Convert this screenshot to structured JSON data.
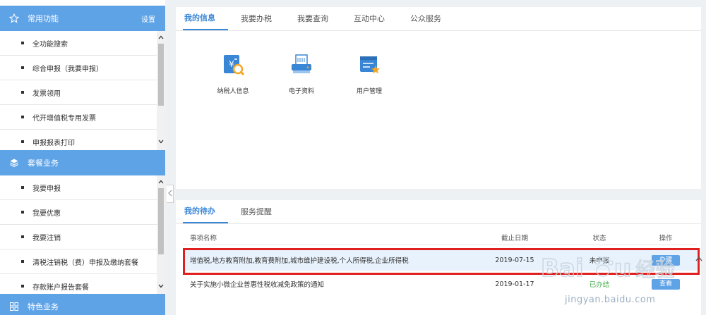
{
  "sidebar": {
    "sections": [
      {
        "title": "常用功能",
        "right_label": "设置",
        "items": [
          "全功能搜索",
          "综合申报（我要申报）",
          "发票领用",
          "代开增值税专用发票",
          "申报报表打印"
        ]
      },
      {
        "title": "套餐业务",
        "items": [
          "我要申报",
          "我要优惠",
          "我要注销",
          "清税注销税（费）申报及缴纳套餐",
          "存款账户报告套餐"
        ]
      },
      {
        "title": "特色业务"
      }
    ]
  },
  "info_panel": {
    "tabs": [
      "我的信息",
      "我要办税",
      "我要查询",
      "互动中心",
      "公众服务"
    ],
    "active_tab": 0,
    "services": [
      {
        "label": "纳税人信息",
        "icon": "taxpayer-info-icon"
      },
      {
        "label": "电子资料",
        "icon": "electronic-document-icon"
      },
      {
        "label": "用户管理",
        "icon": "user-management-icon"
      }
    ]
  },
  "todo_panel": {
    "tabs": [
      "我的待办",
      "服务提醒"
    ],
    "active_tab": 0,
    "columns": {
      "name": "事项名称",
      "date": "截止日期",
      "status": "状态",
      "op": "操作"
    },
    "rows": [
      {
        "name": "增值税,地方教育附加,教育费附加,城市维护建设税,个人所得税,企业所得税",
        "date": "2019-07-15",
        "status": "未申报",
        "op": "办理"
      },
      {
        "name": "关于实施小微企业普惠性税收减免政策的通知",
        "date": "2019-01-17",
        "status": "已办结",
        "op": "查看"
      }
    ]
  },
  "watermark": {
    "brand": "Baidu 经验",
    "url": "jingyan.baidu.com"
  },
  "colors": {
    "accent": "#5fa3e7",
    "active_tab": "#3a86d6",
    "highlight": "#e0201f",
    "row_highlight": "#e8f2fc"
  }
}
